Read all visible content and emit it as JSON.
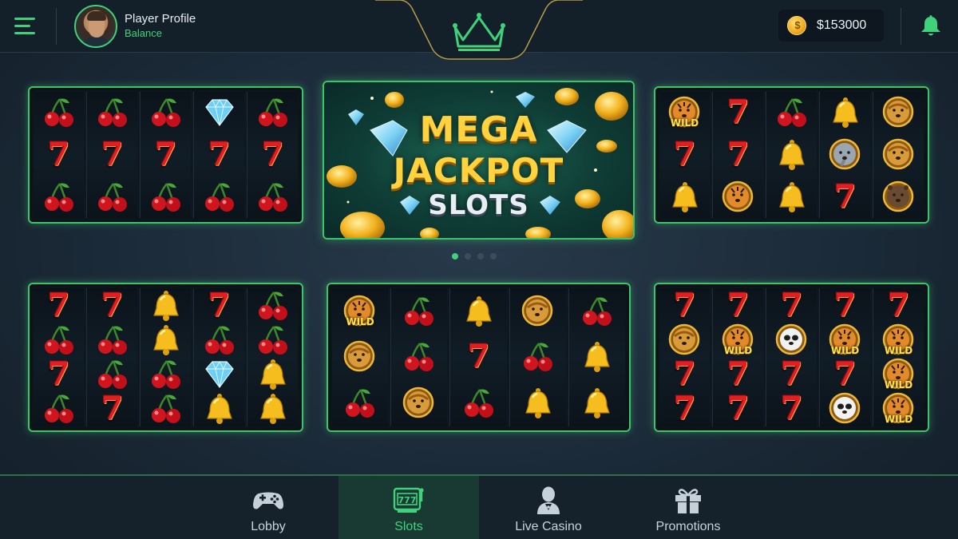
{
  "header": {
    "profile_name": "Player Profile",
    "profile_sub": "Balance",
    "balance": "$153000"
  },
  "jackpot": {
    "line1": "MEGA",
    "line2": "JACKPOT",
    "line3": "SLOTS"
  },
  "carousel": {
    "count": 4,
    "active_index": 0
  },
  "machines": [
    {
      "reels": [
        [
          "cherry",
          "seven",
          "cherry"
        ],
        [
          "cherry",
          "seven",
          "cherry"
        ],
        [
          "cherry",
          "seven",
          "cherry"
        ],
        [
          "diamond",
          "seven",
          "cherry"
        ],
        [
          "cherry",
          "seven",
          "cherry"
        ]
      ]
    },
    {
      "reels": [
        [
          "tiger-wild",
          "seven",
          "bell"
        ],
        [
          "seven",
          "seven",
          "tiger"
        ],
        [
          "cherry",
          "bell",
          "bell"
        ],
        [
          "bell",
          "elephant",
          "seven"
        ],
        [
          "lion",
          "lion",
          "bear"
        ]
      ]
    },
    {
      "reels": [
        [
          "seven",
          "cherry",
          "seven",
          "cherry"
        ],
        [
          "seven",
          "cherry",
          "cherry",
          "seven"
        ],
        [
          "bell",
          "bell",
          "cherry",
          "cherry"
        ],
        [
          "seven",
          "cherry",
          "diamond",
          "bell"
        ],
        [
          "cherry",
          "cherry",
          "bell",
          "bell"
        ]
      ]
    },
    {
      "reels": [
        [
          "tiger-wild",
          "lion",
          "cherry"
        ],
        [
          "cherry",
          "cherry",
          "lion"
        ],
        [
          "bell",
          "seven",
          "cherry"
        ],
        [
          "lion",
          "cherry",
          "bell"
        ],
        [
          "cherry",
          "bell",
          "bell"
        ]
      ]
    },
    {
      "reels": [
        [
          "seven",
          "lion",
          "seven",
          "seven"
        ],
        [
          "seven",
          "tiger-wild",
          "seven",
          "seven"
        ],
        [
          "seven",
          "panda",
          "seven",
          "seven"
        ],
        [
          "seven",
          "tiger-wild",
          "seven",
          "panda"
        ],
        [
          "seven",
          "tiger-wild",
          "tiger-wild",
          "tiger-wild"
        ]
      ]
    }
  ],
  "symbol_labels": {
    "wild": "WILD",
    "seven": "7"
  },
  "nav": [
    {
      "label": "Lobby",
      "icon": "gamepad-icon",
      "active": false
    },
    {
      "label": "Slots",
      "icon": "slot-machine-icon",
      "active": true
    },
    {
      "label": "Live Casino",
      "icon": "dealer-icon",
      "active": false
    },
    {
      "label": "Promotions",
      "icon": "gift-icon",
      "active": false
    }
  ],
  "colors": {
    "accent": "#3fd27a",
    "gold": "#ffd23e",
    "background": "#1b2a38"
  }
}
